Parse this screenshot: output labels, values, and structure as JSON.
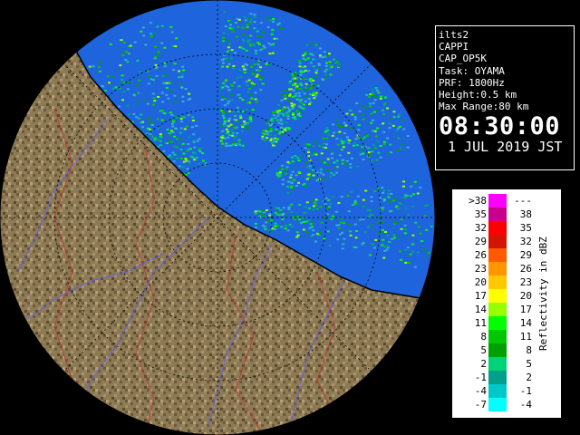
{
  "info": {
    "station": "ilts2",
    "product": "CAPPI",
    "product_code": "CAP_OP5K",
    "task": "Task: OYAMA",
    "prf": "PRF: 1800Hz",
    "height": "Height:0.5 km",
    "max_range": "Max Range:80 km",
    "time": "08:30:00",
    "date": "1 JUL 2019 JST"
  },
  "legend": {
    "title": "Reflectivity in dBZ",
    "rows": [
      {
        "lo": ">38",
        "hi": "---",
        "color": "#ff00ff"
      },
      {
        "lo": "35",
        "hi": "38",
        "color": "#c8008c"
      },
      {
        "lo": "32",
        "hi": "35",
        "color": "#ff0000"
      },
      {
        "lo": "29",
        "hi": "32",
        "color": "#d21400"
      },
      {
        "lo": "26",
        "hi": "29",
        "color": "#ff5a00"
      },
      {
        "lo": "23",
        "hi": "26",
        "color": "#ff9600"
      },
      {
        "lo": "20",
        "hi": "23",
        "color": "#ffc800"
      },
      {
        "lo": "17",
        "hi": "20",
        "color": "#ffff00"
      },
      {
        "lo": "14",
        "hi": "17",
        "color": "#96ff00"
      },
      {
        "lo": "11",
        "hi": "14",
        "color": "#00ff00"
      },
      {
        "lo": "8",
        "hi": "11",
        "color": "#00c800"
      },
      {
        "lo": "5",
        "hi": "8",
        "color": "#00a000"
      },
      {
        "lo": "2",
        "hi": "5",
        "color": "#00d278"
      },
      {
        "lo": "-1",
        "hi": "2",
        "color": "#00a08c"
      },
      {
        "lo": "-4",
        "hi": "-1",
        "color": "#00c8c8"
      },
      {
        "lo": "-7",
        "hi": "-4",
        "color": "#00ffff"
      }
    ]
  },
  "colors": {
    "sea": "#1e64dc",
    "echo_weak": "#3caadc",
    "land": "#8c7a55",
    "ring": "#000000"
  }
}
